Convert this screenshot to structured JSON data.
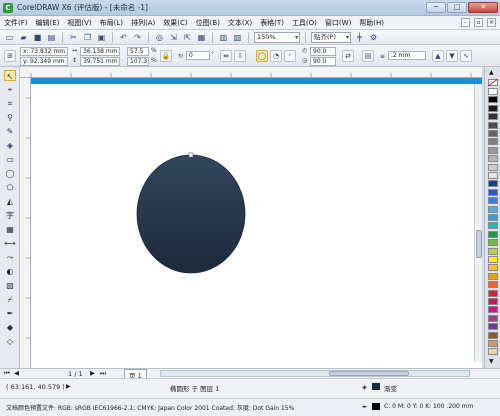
{
  "window": {
    "title": "CorelDRAW X6 (评估版) - [未命名 -1]",
    "app_icon": "coreldraw-logo-icon"
  },
  "window_buttons": {
    "minimize": "─",
    "maximize": "□",
    "close": "✕"
  },
  "menu": [
    "文件(F)",
    "编辑(E)",
    "视图(V)",
    "布局(L)",
    "排列(A)",
    "效果(C)",
    "位图(B)",
    "文本(X)",
    "表格(T)",
    "工具(O)",
    "窗口(W)",
    "帮助(H)"
  ],
  "standard_toolbar": {
    "zoom": "150%",
    "snap": "贴齐(P)"
  },
  "properties": {
    "x": "x: 73.832 mm",
    "y": "y: 92.349 mm",
    "width": "36.138 mm",
    "height": "39.751 mm",
    "scale_w": "57.5",
    "scale_h": "107.3",
    "scale_unit": "%",
    "rotation": "0",
    "rotation_unit": "°",
    "start_angle": "90.0",
    "end_angle": "90.0",
    "outline_width": ".2 mm"
  },
  "page_nav": {
    "counter": "1 / 1",
    "tab": "页 1"
  },
  "status": {
    "coords": "( 63.161, 40.579 )",
    "object": "椭圆形 于 图层 1",
    "fill_name": "渐变",
    "outline_spec": "C: 0 M: 0 Y: 0 K: 100  .200 mm",
    "color_profile": "文档颜色预置文件: RGB: sRGB IEC61966-2.1; CMYK: Japan Color 2001 Coated; 灰度: Dot Gain 15%"
  },
  "colors": {
    "ellipse_top": "#33465b",
    "ellipse_bottom": "#1c2a3a",
    "page_band": "#1c8ed8",
    "palette": [
      "#ffffff",
      "#000000",
      "#1a1a1a",
      "#333333",
      "#4d4d4d",
      "#666666",
      "#808080",
      "#999999",
      "#b3b3b3",
      "#cccccc",
      "#e6e6e6",
      "#1a3d8f",
      "#2b58c7",
      "#3b7bd9",
      "#5ea6e8",
      "#2aa5d8",
      "#22b5b5",
      "#1c9b4a",
      "#6cbe45",
      "#b8d433",
      "#fff200",
      "#f9c80e",
      "#f39a1f",
      "#f26522",
      "#ed1c24",
      "#c3185a",
      "#ec008c",
      "#a13b96",
      "#6a3d9a",
      "#8b5a2b",
      "#c69c6d",
      "#e8d4b0"
    ]
  }
}
